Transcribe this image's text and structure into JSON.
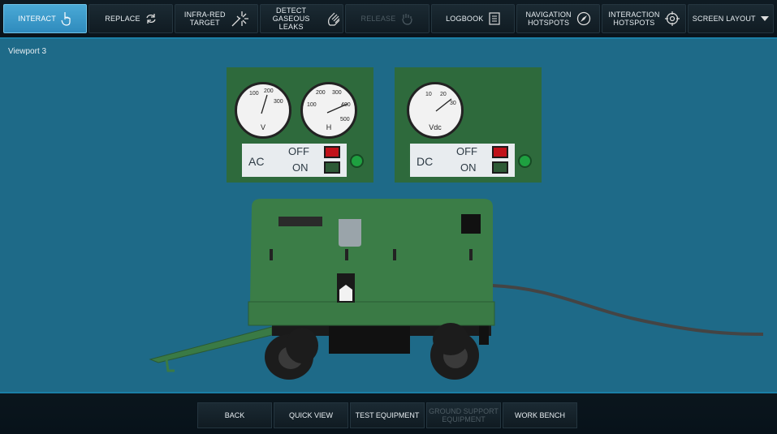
{
  "toolbar": {
    "interact": "Interact",
    "replace": "Replace",
    "infrared_1": "Infra-red",
    "infrared_2": "target",
    "detect_1": "Detect",
    "detect_2": "gaseous leaks",
    "release": "Release",
    "logbook": "Logbook",
    "nav_1": "Navigation",
    "nav_2": "hotspots",
    "inter_1": "Interaction",
    "inter_2": "hotspots",
    "screen_layout": "Screen layout"
  },
  "viewport": {
    "label": "Viewport 3"
  },
  "ac_panel": {
    "voltmeter": {
      "t1": "100",
      "t2": "200",
      "t3": "300",
      "unit": "V"
    },
    "freqmeter": {
      "t1": "200",
      "t2": "300",
      "t3": "100",
      "t4": "400",
      "t5": "500",
      "unit": "H"
    },
    "switch_label": "AC",
    "off": "OFF",
    "on": "ON"
  },
  "dc_panel": {
    "voltmeter": {
      "t1": "10",
      "t2": "20",
      "t3": "30",
      "unit": "Vdc"
    },
    "switch_label": "DC",
    "off": "OFF",
    "on": "ON"
  },
  "bottom": {
    "back": "Back",
    "quick_view": "Quick view",
    "test_equipment": "Test equipment",
    "gse_1": "Ground support",
    "gse_2": "equipment",
    "work_bench": "Work bench"
  },
  "colors": {
    "accent": "#2f8bbd",
    "viewport_bg": "#1e6a88",
    "panel": "#2e6a3c",
    "generator": "#3a7a45"
  }
}
